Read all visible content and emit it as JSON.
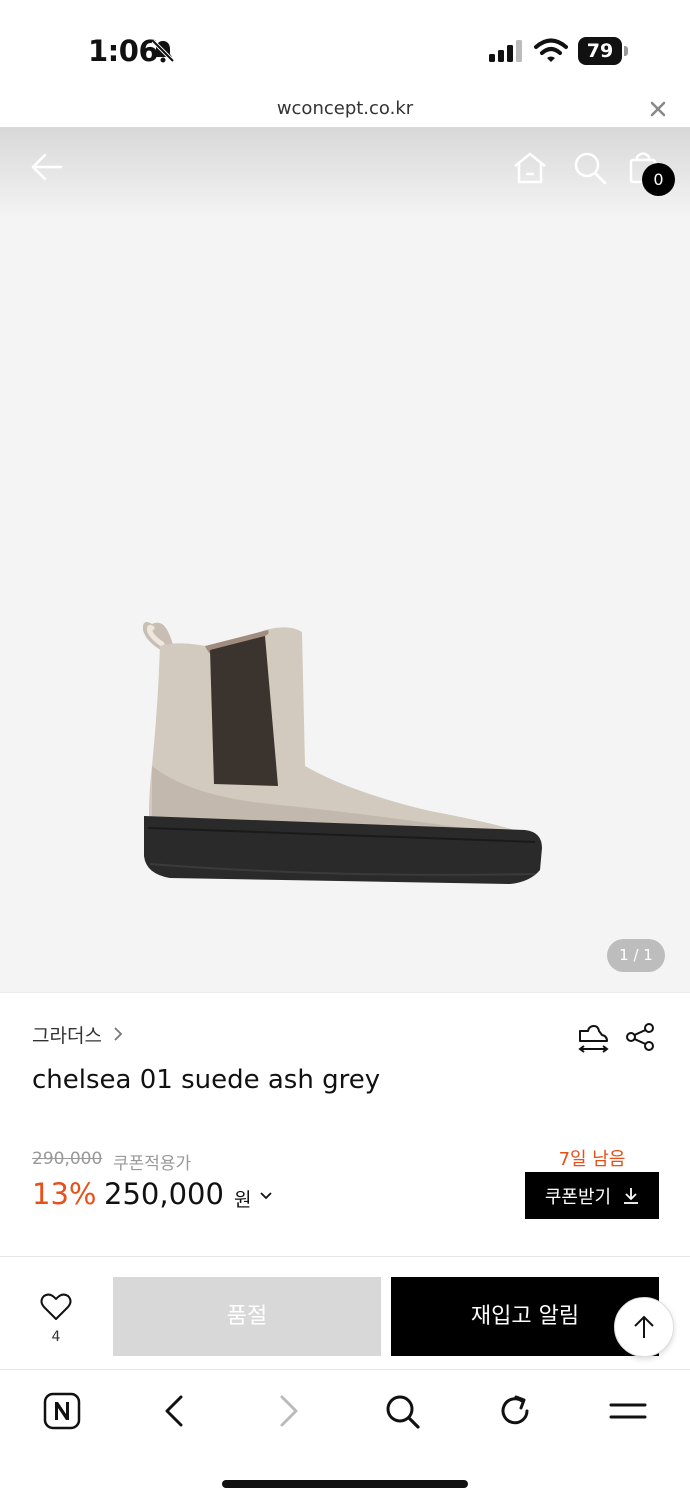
{
  "status_bar": {
    "time": "1:06",
    "battery": "79",
    "icons": [
      "bell-slash-icon",
      "signal-icon",
      "wifi-icon",
      "battery-icon"
    ]
  },
  "browser": {
    "url": "wconcept.co.kr"
  },
  "header": {
    "icons": [
      "back-arrow-icon",
      "home-icon",
      "search-icon",
      "shopping-bag-icon"
    ],
    "cart_count": "0"
  },
  "gallery": {
    "counter": "1 / 1"
  },
  "product": {
    "brand": "그라더스",
    "name": "chelsea 01 suede ash grey",
    "original_price": "290,000",
    "coupon_label": "쿠폰적용가",
    "discount": "13%",
    "sale_price": "250,000",
    "currency": "원",
    "days_left": "7일 남음",
    "coupon_button": "쿠폰받기"
  },
  "actions": {
    "like_count": "4",
    "soldout_label": "품절",
    "restock_label": "재입고 알림"
  },
  "toolbar": {
    "icons": [
      "naver-icon",
      "back-icon",
      "forward-icon",
      "search-icon",
      "refresh-icon",
      "menu-icon"
    ]
  },
  "colors": {
    "accent": "#e8501a",
    "primary": "#000000",
    "disabled": "#d8d8d8",
    "hero_bg": "#f4f4f4"
  }
}
